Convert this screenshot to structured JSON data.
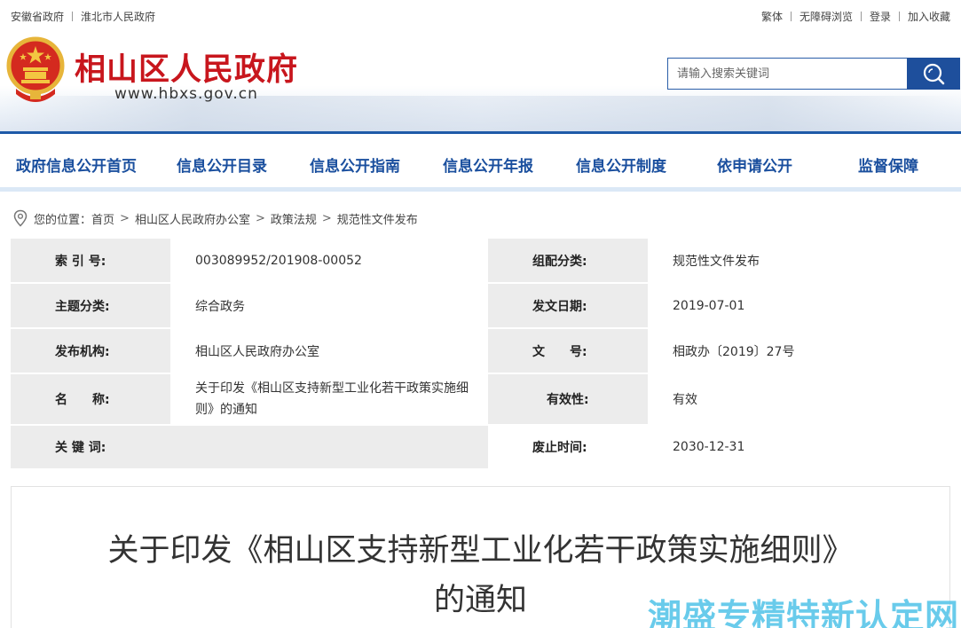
{
  "topbar": {
    "left_links": [
      "安徽省政府",
      "淮北市人民政府"
    ],
    "right_links": [
      "繁体",
      "无障碍浏览",
      "登录",
      "加入收藏"
    ]
  },
  "header": {
    "title": "相山区人民政府",
    "url": "www.hbxs.gov.cn",
    "brand_color": "#c8161d"
  },
  "search": {
    "placeholder": "请输入搜索关键词"
  },
  "nav": {
    "items": [
      "政府信息公开首页",
      "信息公开目录",
      "信息公开指南",
      "信息公开年报",
      "信息公开制度",
      "依申请公开",
      "监督保障"
    ],
    "color": "#1a4f9e"
  },
  "breadcrumb": {
    "prefix": "您的位置：",
    "items": [
      "首页",
      "相山区人民政府办公室",
      "政策法规",
      "规范性文件发布"
    ]
  },
  "info": {
    "rows": [
      {
        "l1": "索 引 号:",
        "v1": "003089952/201908-00052",
        "l2": "组配分类:",
        "v2": "规范性文件发布"
      },
      {
        "l1": "主题分类:",
        "v1": "综合政务",
        "l2": "发文日期:",
        "v2": "2019-07-01"
      },
      {
        "l1": "发布机构:",
        "v1": "相山区人民政府办公室",
        "l2": "文　　号:",
        "v2": "相政办〔2019〕27号"
      },
      {
        "l1": "名　　称:",
        "v1": "关于印发《相山区支持新型工业化若干政策实施细则》的通知",
        "l2": "有效性:",
        "v2": "有效"
      },
      {
        "l1": "关 键 词:",
        "v1": "",
        "l2": "废止时间:",
        "v2": "2030-12-31"
      }
    ]
  },
  "article": {
    "title_line1": "关于印发《相山区支持新型工业化若干政策实施细则》",
    "title_line2": "的通知"
  },
  "watermark": "潮盛专精特新认定网"
}
